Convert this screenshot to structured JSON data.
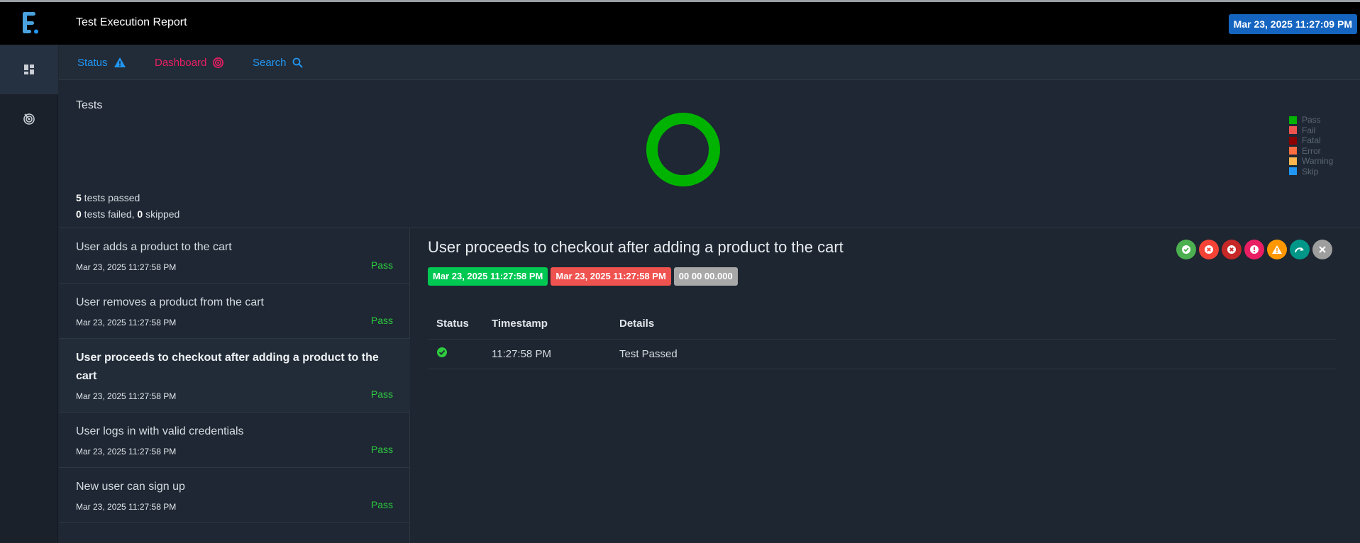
{
  "app": {
    "title": "Test Execution Report",
    "datetime": "Mar 23, 2025 11:27:09 PM"
  },
  "sidebar": {
    "items": [
      {
        "icon": "dashboard-grid-icon"
      },
      {
        "icon": "radar-icon"
      }
    ]
  },
  "nav": {
    "status_label": "Status",
    "dashboard_label": "Dashboard",
    "search_label": "Search"
  },
  "summary": {
    "title": "Tests",
    "passed_count": "5",
    "passed_text": " tests passed",
    "failed_count": "0",
    "failed_text": " tests failed, ",
    "skipped_count": "0",
    "skipped_text": " skipped",
    "legend": [
      {
        "label": "Pass",
        "color": "#00b300"
      },
      {
        "label": "Fail",
        "color": "#ef5350"
      },
      {
        "label": "Fatal",
        "color": "#8b0000"
      },
      {
        "label": "Error",
        "color": "#ff6e40"
      },
      {
        "label": "Warning",
        "color": "#ffb74d"
      },
      {
        "label": "Skip",
        "color": "#2196f3"
      }
    ],
    "donut": {
      "pass": 5,
      "fail": 0,
      "fatal": 0,
      "error": 0,
      "warning": 0,
      "skip": 0
    }
  },
  "tests": [
    {
      "name": "User adds a product to the cart",
      "time": "Mar 23, 2025 11:27:58 PM",
      "status": "Pass"
    },
    {
      "name": "User removes a product from the cart",
      "time": "Mar 23, 2025 11:27:58 PM",
      "status": "Pass"
    },
    {
      "name": "User proceeds to checkout after adding a product to the cart",
      "time": "Mar 23, 2025 11:27:58 PM",
      "status": "Pass"
    },
    {
      "name": "User logs in with valid credentials",
      "time": "Mar 23, 2025 11:27:58 PM",
      "status": "Pass"
    },
    {
      "name": "New user can sign up",
      "time": "Mar 23, 2025 11:27:58 PM",
      "status": "Pass"
    }
  ],
  "detail": {
    "title": "User proceeds to checkout after adding a product to the cart",
    "start_time": "Mar 23, 2025 11:27:58 PM",
    "end_time": "Mar 23, 2025 11:27:58 PM",
    "duration": "00 00 00.000",
    "filters": [
      {
        "name": "pass-filter-icon",
        "color": "#4caf50"
      },
      {
        "name": "fail-filter-icon",
        "color": "#f44336"
      },
      {
        "name": "fatal-filter-icon",
        "color": "#c62828"
      },
      {
        "name": "error-filter-icon",
        "color": "#e91e63"
      },
      {
        "name": "warning-filter-icon",
        "color": "#ff9800"
      },
      {
        "name": "skip-filter-icon",
        "color": "#009688"
      },
      {
        "name": "clear-filter-icon",
        "color": "#9e9e9e"
      }
    ],
    "log_headers": {
      "status": "Status",
      "timestamp": "Timestamp",
      "details": "Details"
    },
    "logs": [
      {
        "status": "pass",
        "timestamp": "11:27:58 PM",
        "details": "Test Passed"
      }
    ]
  }
}
